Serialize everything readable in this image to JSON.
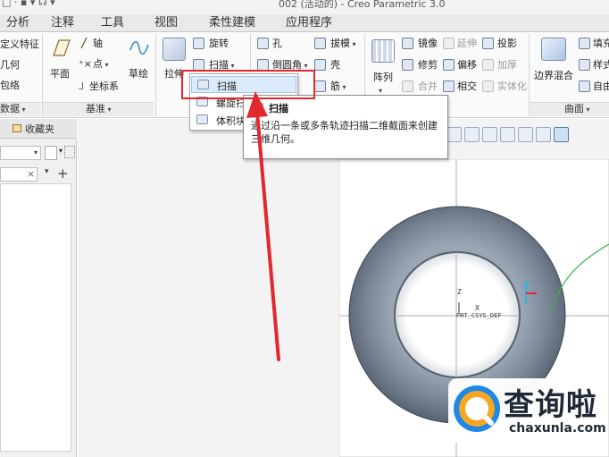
{
  "titlebar": {
    "quick_access": "□ ·  ▪  ▾  ☊ ▾",
    "title": "002 (活动的) - Creo Parametric 3.0"
  },
  "tabs": [
    {
      "label": "分析"
    },
    {
      "label": "注释"
    },
    {
      "label": "工具"
    },
    {
      "label": "视图"
    },
    {
      "label": "柔性建模"
    },
    {
      "label": "应用程序"
    }
  ],
  "ribbon": {
    "data_group": {
      "label": "数据",
      "items": [
        "定义特征",
        "几何",
        "包络"
      ]
    },
    "datum_group": {
      "label": "基准",
      "plane": "平面",
      "axis": "轴",
      "point": "点",
      "csys": "坐标系",
      "sketch": "草绘"
    },
    "shapes_group": {
      "extrude": "拉伸",
      "revolve": "旋转",
      "sweep": "扫描"
    },
    "engineering_group": {
      "hole": "孔",
      "round": "倒圆角",
      "draft": "拔模",
      "shell": "壳",
      "rib": "筋"
    },
    "editing_group": {
      "pattern": "阵列",
      "mirror": "镜像",
      "trim": "修剪",
      "merge": "合并",
      "extend": "延伸",
      "offset": "偏移",
      "intersect": "相交",
      "project": "投影",
      "thicken": "加厚",
      "solidify": "实体化"
    },
    "surfaces_group": {
      "label": "曲面",
      "boundary_blend": "边界混合",
      "fill": "填充",
      "style": "样式",
      "freestyle": "自由式"
    }
  },
  "sweep_menu": {
    "items": [
      {
        "label": "扫描"
      },
      {
        "label": "螺旋扫描"
      },
      {
        "label": "体积块扫描"
      }
    ]
  },
  "tooltip": {
    "title": "扫描",
    "description": "通过沿一条或多条轨迹扫描二维截面来创建三维几何。"
  },
  "left_panel": {
    "favorites_tab": "收藏夹",
    "search_clear": "×",
    "add": "+"
  },
  "model": {
    "csys_label": "PRT_CSYS_DEF",
    "z_label": "Z",
    "x_label": "X"
  },
  "watermark": {
    "cn": "查询啦",
    "en": "chaxunla.com"
  },
  "colors": {
    "highlight_red": "#e0282d",
    "torus": "#6d7b8c",
    "trajectory_green": "#3bb54a"
  }
}
